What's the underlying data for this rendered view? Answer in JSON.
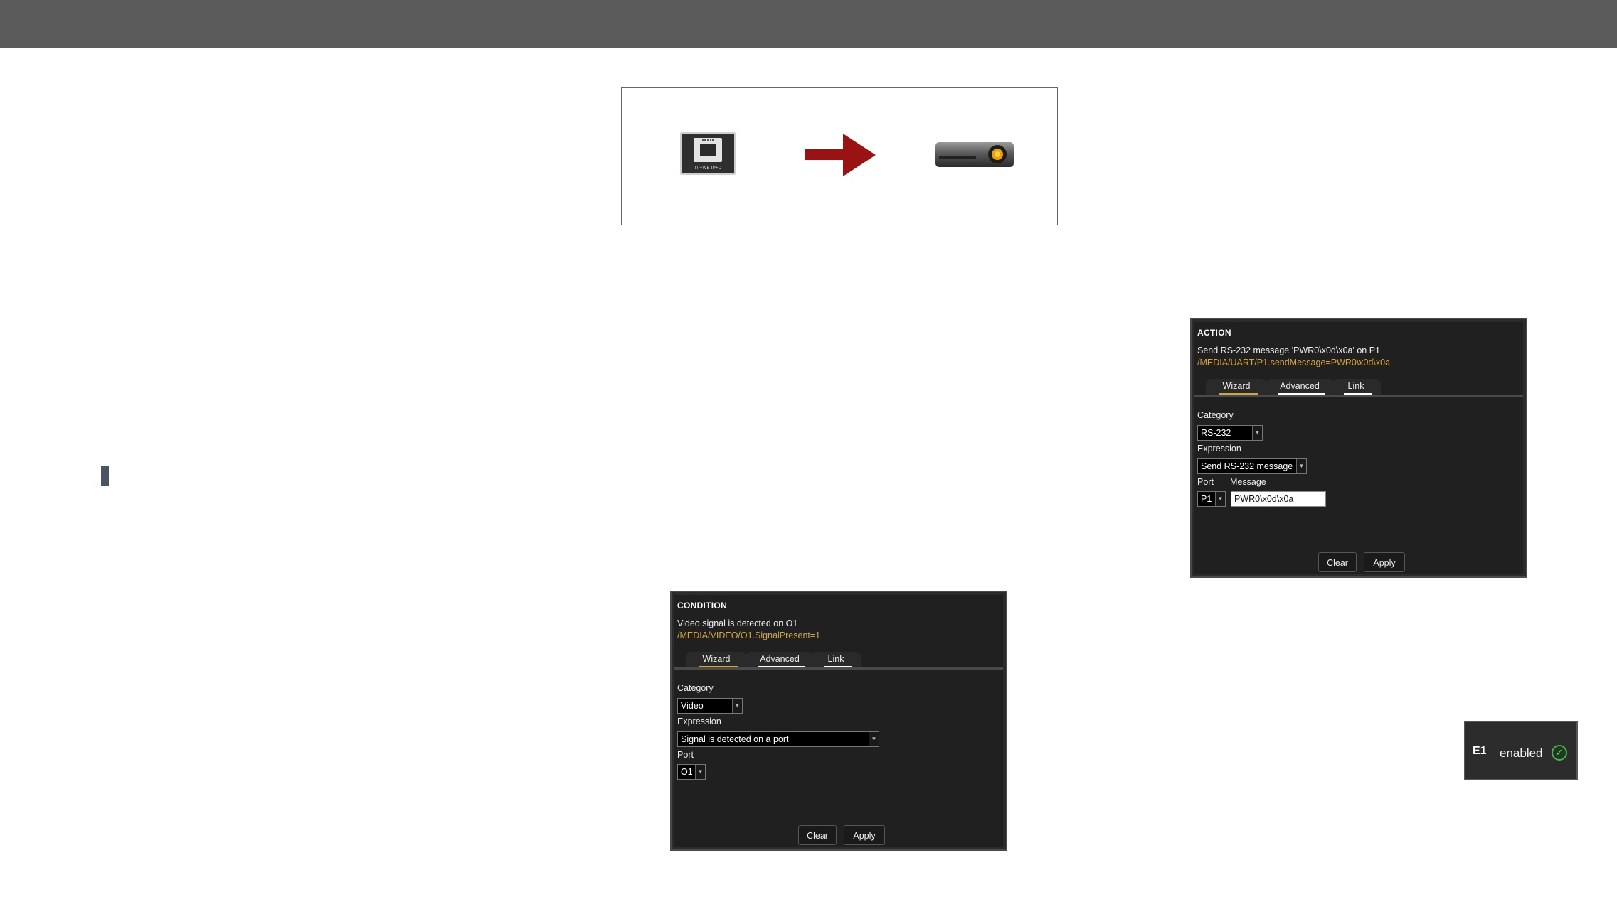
{
  "diagram": {
    "port_label": "TP+WB IP+D",
    "icons": [
      "rj45-port-icon",
      "right-arrow-icon",
      "projector-icon"
    ]
  },
  "action_panel": {
    "title": "ACTION",
    "description": "Send RS-232 message 'PWR0\\x0d\\x0a' on P1",
    "path": "/MEDIA/UART/P1.sendMessage=PWR0\\x0d\\x0a",
    "tabs": [
      {
        "label": "Wizard"
      },
      {
        "label": "Advanced"
      },
      {
        "label": "Link"
      }
    ],
    "category_label": "Category",
    "category_value": "RS-232",
    "expression_label": "Expression",
    "expression_value": "Send RS-232 message",
    "port_label": "Port",
    "port_value": "P1",
    "message_label": "Message",
    "message_value": "PWR0\\x0d\\x0a",
    "clear_label": "Clear",
    "apply_label": "Apply"
  },
  "condition_panel": {
    "title": "CONDITION",
    "description": "Video signal is detected on O1",
    "path": "/MEDIA/VIDEO/O1.SignalPresent=1",
    "tabs": [
      {
        "label": "Wizard"
      },
      {
        "label": "Advanced"
      },
      {
        "label": "Link"
      }
    ],
    "category_label": "Category",
    "category_value": "Video",
    "expression_label": "Expression",
    "expression_value": "Signal is detected on a port",
    "port_label": "Port",
    "port_value": "O1",
    "clear_label": "Clear",
    "apply_label": "Apply"
  },
  "status_badge": {
    "id": "E1",
    "state": "enabled"
  }
}
